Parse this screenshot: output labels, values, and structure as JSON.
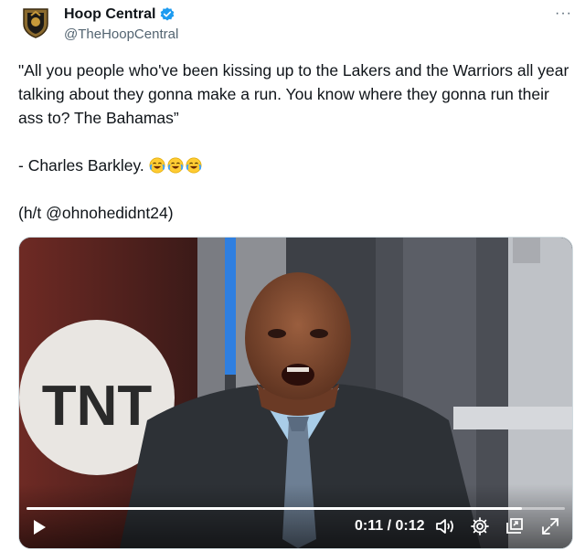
{
  "author": {
    "display_name": "Hoop Central",
    "handle": "@TheHoopCentral",
    "verified_icon": "verified-badge-icon",
    "avatar_icon": "shield-logo-icon"
  },
  "more_icon": "more-options-icon",
  "tweet": {
    "quote": "\"All you people who've been kissing up to the Lakers and the Warriors all year talking about they gonna make a run. You know where they gonna run their ass to? The Bahamas”",
    "attribution": "- Charles Barkley.",
    "attribution_emoji_count": 3,
    "credit": "(h/t @ohnohedidnt24)"
  },
  "video": {
    "time_display": "0:11 / 0:12",
    "progress": 0.92,
    "controls": [
      "play-icon",
      "volume-icon",
      "settings-icon",
      "picture-in-picture-icon",
      "fullscreen-icon"
    ],
    "screen_logo": "TNT"
  },
  "colors": {
    "verified": "#1d9bf0",
    "text_primary": "#0f1419",
    "text_secondary": "#536471",
    "border": "#cfd9de"
  }
}
